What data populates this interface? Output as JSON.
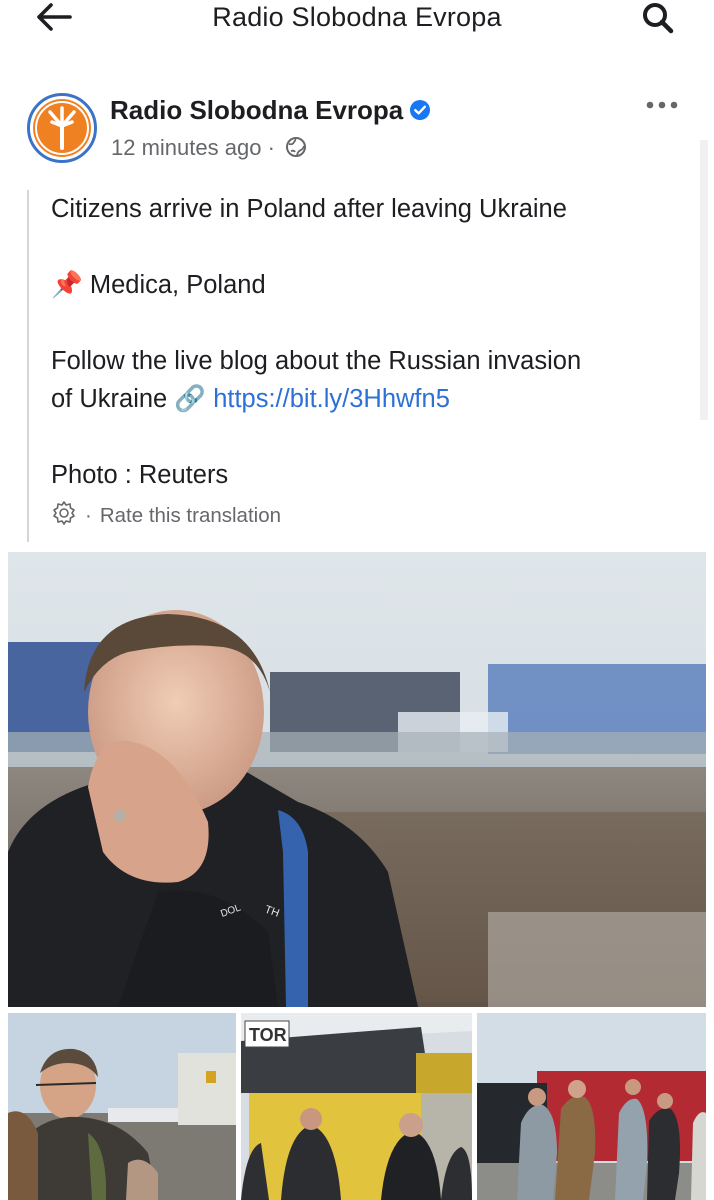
{
  "header": {
    "title": "Radio Slobodna Evropa",
    "back_icon": "arrow-left-icon",
    "search_icon": "search-icon"
  },
  "post": {
    "author": "Radio Slobodna Evropa",
    "verified_icon": "verified-badge-icon",
    "time": "12 minutes ago",
    "separator": "·",
    "privacy_icon": "globe-icon",
    "more_icon": "more-horizontal-icon",
    "lines": {
      "headline": "Citizens arrive in Poland after leaving Ukraine",
      "location_icon": "📌",
      "location": "Medica, Poland",
      "live_blog_1": "Follow the live blog about the Russian invasion",
      "live_blog_2": "of Ukraine",
      "link_icon": "🔗",
      "link": "https://bit.ly/3Hhwfn5",
      "credit": "Photo : Reuters"
    },
    "translation": {
      "gear_icon": "gear-icon",
      "separator": "·",
      "label": "Rate this translation"
    }
  },
  "photos": {
    "main_jacket_text": "TH",
    "main_zip_text": "DOL",
    "thumb2_sign": "TOR"
  },
  "colors": {
    "link": "#2d70d6",
    "verified": "#1877f2",
    "logo_orange": "#f08122",
    "logo_ring": "#3b74c7",
    "meta_gray": "#65676b"
  }
}
